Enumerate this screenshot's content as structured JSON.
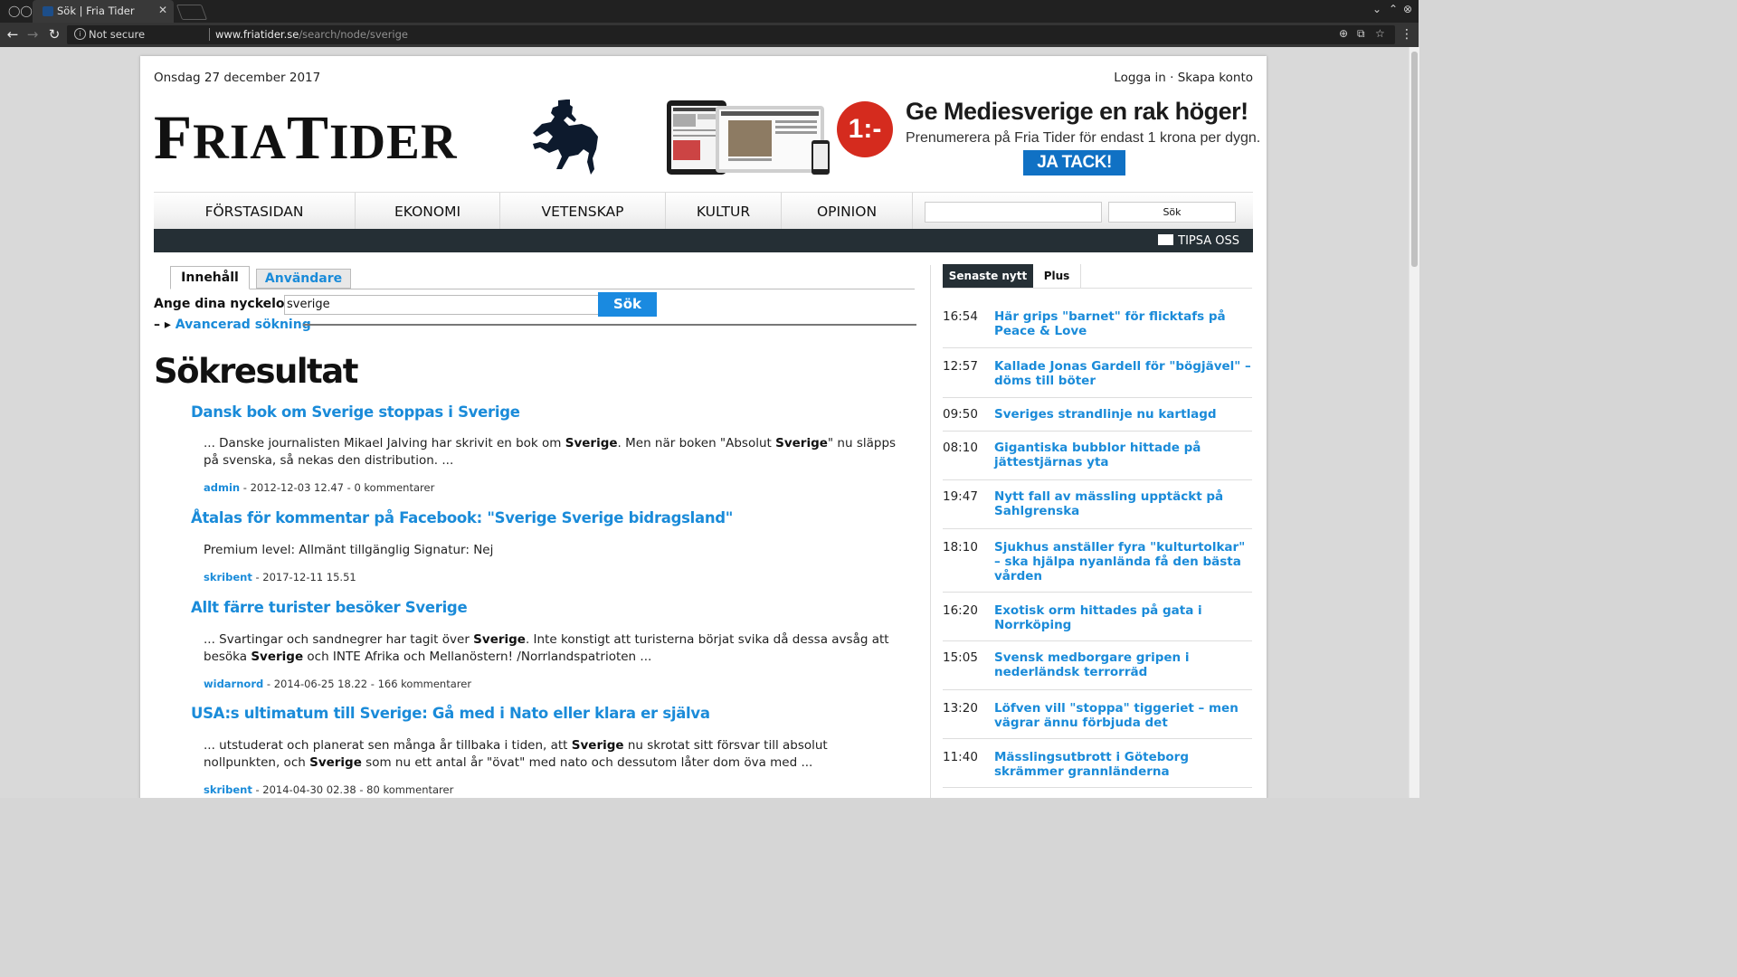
{
  "browser": {
    "tab_title": "Sök | Fria Tider",
    "not_secure": "Not secure",
    "url_host": "www.friatider.se",
    "url_path": "/search/node/sverige"
  },
  "site": {
    "date": "Onsdag 27 december 2017",
    "login": "Logga in",
    "login_sep": " · ",
    "register": "Skapa konto",
    "logo_f": "F",
    "logo_ria": "RIA",
    "logo_t": "T",
    "logo_ider": "IDER"
  },
  "ad": {
    "badge": "1:-",
    "headline": "Ge Mediesverige en rak höger!",
    "subline": "Prenumerera på Fria Tider för endast 1 krona per dygn.",
    "cta": "JA TACK!"
  },
  "nav": {
    "items": [
      "FÖRSTASIDAN",
      "EKONOMI",
      "VETENSKAP",
      "KULTUR",
      "OPINION"
    ],
    "search_button": "Sök",
    "tipsa": "TIPSA OSS"
  },
  "search": {
    "tabs": [
      "Innehåll",
      "Användare"
    ],
    "keyword_label": "Ange dina nyckelord",
    "keyword_value": "sverige",
    "button": "Sök",
    "advanced_dash": "–",
    "advanced_arrow": "▸",
    "advanced": "Avancerad sökning",
    "results_title": "Sökresultat"
  },
  "results": [
    {
      "title": "Dansk bok om Sverige stoppas i Sverige",
      "s1": "... Danske journalisten Mikael Jalving har skrivit en bok om ",
      "b1": "Sverige",
      "s2": ". Men när boken \"Absolut ",
      "b2": "Sverige",
      "s3": "\" nu släpps på svenska, så nekas den distribution. ...",
      "author": "admin",
      "meta": " - 2012-12-03 12.47 - 0 kommentarer"
    },
    {
      "title": "Åtalas för kommentar på Facebook: \"Sverige Sverige bidragsland\"",
      "s1": "Premium level:  Allmänt tillgänglig Signatur:  Nej",
      "author": "skribent",
      "meta": " - 2017-12-11 15.51"
    },
    {
      "title": "Allt färre turister besöker Sverige",
      "s1": "... Svartingar och sandnegrer har tagit över ",
      "b1": "Sverige",
      "s2": ". Inte konstigt att turisterna börjat svika då dessa avsåg att besöka ",
      "b2": "Sverige",
      "s3": " och INTE Afrika och Mellanöstern! /Norrlandspatrioten ...",
      "author": "widarnord",
      "meta": " - 2014-06-25 18.22 - 166 kommentarer"
    },
    {
      "title": "USA:s ultimatum till Sverige: Gå med i Nato eller klara er själva",
      "s1": "... utstuderat och planerat sen många år tillbaka i tiden, att ",
      "b1": "Sverige",
      "s2": " nu skrotat sitt försvar till absolut nollpunkten, och ",
      "b2": "Sverige",
      "s3": " som nu ett antal år \"övat\" med nato och dessutom låter dom öva med ...",
      "author": "skribent",
      "meta": " - 2014-04-30 02.38 - 80 kommentarer"
    }
  ],
  "sidebar": {
    "tabs": [
      "Senaste nytt",
      "Plus"
    ],
    "news": [
      {
        "time": "16:54",
        "title": "Här grips \"barnet\" för flicktafs på Peace & Love"
      },
      {
        "time": "12:57",
        "title": "Kallade Jonas Gardell för \"bögjävel\" – döms till böter"
      },
      {
        "time": "09:50",
        "title": "Sveriges strandlinje nu kartlagd"
      },
      {
        "time": "08:10",
        "title": "Gigantiska bubblor hittade på jättestjärnas yta"
      },
      {
        "time": "19:47",
        "title": "Nytt fall av mässling upptäckt på Sahlgrenska"
      },
      {
        "time": "18:10",
        "title": "Sjukhus anställer fyra \"kulturtolkar\" – ska hjälpa nyanlända få den bästa vården"
      },
      {
        "time": "16:20",
        "title": "Exotisk orm hittades på gata i Norrköping"
      },
      {
        "time": "15:05",
        "title": "Svensk medborgare gripen i nederländsk terrorräd"
      },
      {
        "time": "13:20",
        "title": "Löfven vill \"stoppa\" tiggeriet – men vägrar ännu förbjuda det"
      },
      {
        "time": "11:40",
        "title": "Mässlingsutbrott i Göteborg skrämmer grannländerna"
      }
    ]
  },
  "colors": {
    "link_blue": "#1a8bd9",
    "dark_bar": "#252f35",
    "ad_red": "#d52b1e",
    "cta_blue": "#1071c4"
  }
}
